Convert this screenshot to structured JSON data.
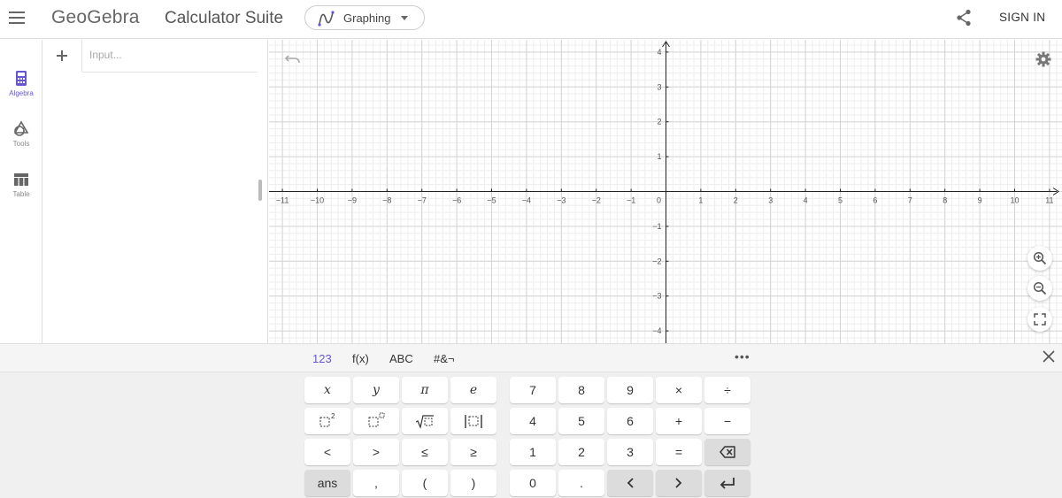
{
  "header": {
    "menu_icon": "hamburger-icon",
    "logo": "GeoGebra",
    "suite_title": "Calculator Suite",
    "app_selector": {
      "label": "Graphing",
      "icon": "graphing-icon"
    },
    "share_icon": "share-icon",
    "sign_in": "SIGN IN"
  },
  "sidebar": {
    "items": [
      {
        "label": "Algebra",
        "icon": "calculator-icon",
        "active": true
      },
      {
        "label": "Tools",
        "icon": "tools-icon",
        "active": false
      },
      {
        "label": "Table",
        "icon": "table-icon",
        "active": false
      }
    ]
  },
  "algebra": {
    "add_icon": "plus-icon",
    "input_placeholder": "Input..."
  },
  "graphics": {
    "x_ticks": [
      "−11",
      "−10",
      "−9",
      "−8",
      "−7",
      "−6",
      "−5",
      "−4",
      "−3",
      "−2",
      "−1",
      "0",
      "1",
      "2",
      "3",
      "4",
      "5",
      "6",
      "7",
      "8",
      "9",
      "10",
      "11"
    ],
    "y_ticks": [
      "4",
      "3",
      "2",
      "1",
      "−1",
      "−2",
      "−3",
      "−4"
    ],
    "x_range": [
      -11,
      11
    ],
    "y_range": [
      -4,
      4
    ],
    "grid": true,
    "undo_icon": "undo-icon",
    "settings_icon": "gear-icon",
    "zoom_in_icon": "zoom-in-icon",
    "zoom_out_icon": "zoom-out-icon",
    "fullscreen_icon": "fullscreen-icon"
  },
  "keyboard": {
    "tabs": [
      "123",
      "f(x)",
      "ABC",
      "#&¬"
    ],
    "active_tab": "123",
    "more": "•••",
    "close_icon": "close-icon",
    "left_keys": [
      [
        "x",
        "y",
        "π",
        "e"
      ],
      [
        "square-icon",
        "power-icon",
        "sqrt-icon",
        "abs-icon"
      ],
      [
        "<",
        ">",
        "≤",
        "≥"
      ],
      [
        "ans",
        ",",
        "(",
        ")"
      ]
    ],
    "right_keys": [
      [
        "7",
        "8",
        "9",
        "×",
        "÷"
      ],
      [
        "4",
        "5",
        "6",
        "+",
        "−"
      ],
      [
        "1",
        "2",
        "3",
        "=",
        "backspace-icon"
      ],
      [
        "0",
        ".",
        "<",
        ">",
        "enter-icon"
      ]
    ],
    "arrow_left": "‹",
    "arrow_right": "›"
  }
}
